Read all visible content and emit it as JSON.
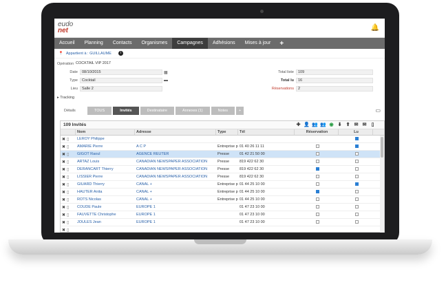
{
  "app": {
    "logo_top": "eudo",
    "logo_bottom": "net"
  },
  "nav": [
    "Accueil",
    "Planning",
    "Contacts",
    "Organismes",
    "Campagnes",
    "Adhésions",
    "Mises à jour"
  ],
  "nav_active": "Campagnes",
  "owner": "Appartient à : GUILLAUME",
  "form": {
    "operation_label": "Opération",
    "operation_value": "COCKTAIL VIP 2017",
    "date_label": "Date",
    "date_value": "08/10/2015",
    "type_label": "Type",
    "type_value": "Cocktail",
    "lieu_label": "Lieu",
    "lieu_value": "Salle 2",
    "total_liste_label": "Total liste",
    "total_liste_value": "109",
    "total_lu_label": "Total lu",
    "total_lu_value": "16",
    "reservations_label": "Réservations",
    "reservations_value": "2"
  },
  "tracking_label": "Tracking",
  "tabs": {
    "label": "Détails",
    "items": [
      "TOUS",
      "Invités",
      "Destinataire",
      "Annexes (1)",
      "Notes",
      "+"
    ],
    "active": "Invités"
  },
  "grid": {
    "title": "109 Invités",
    "columns": [
      "Nom",
      "Adresse",
      "Type",
      "Tél",
      "Réservation",
      "Lu"
    ],
    "rows": [
      {
        "nom": "LEROY Philippe",
        "adresse": "",
        "type": "",
        "tel": "",
        "reservation": null,
        "lu": true,
        "selected": false
      },
      {
        "nom": "AMARIE Pierre",
        "adresse": "A C P",
        "type": "Entreprise p...",
        "tel": "01 40 26 11 11",
        "reservation": false,
        "lu": true,
        "selected": false
      },
      {
        "nom": "GIGOT Raoul",
        "adresse": "AGENCE REUTER",
        "type": "Presse",
        "tel": "01 42 21 50 00",
        "reservation": false,
        "lu": false,
        "selected": true
      },
      {
        "nom": "ARTAZ Louis",
        "adresse": "CANADIAN NEWSPAPER ASSOCIATION",
        "type": "Presse",
        "tel": "819 422 62 30",
        "reservation": false,
        "lu": false,
        "selected": false
      },
      {
        "nom": "DERANCART Thierry",
        "adresse": "CANADIAN NEWSPAPER ASSOCIATION",
        "type": "Presse",
        "tel": "819 422 62 30",
        "reservation": true,
        "lu": false,
        "selected": false
      },
      {
        "nom": "LISSIER Pierre",
        "adresse": "CANADIAN NEWSPAPER ASSOCIATION",
        "type": "Presse",
        "tel": "819 422 62 30",
        "reservation": false,
        "lu": false,
        "selected": false
      },
      {
        "nom": "GIUARD Thierry",
        "adresse": "CANAL +",
        "type": "Entreprise p...",
        "tel": "01 44 25 10 00",
        "reservation": false,
        "lu": true,
        "selected": false
      },
      {
        "nom": "HAUTER Anita",
        "adresse": "CANAL +",
        "type": "Entreprise p...",
        "tel": "01 44 25 10 00",
        "reservation": true,
        "lu": false,
        "selected": false
      },
      {
        "nom": "ROTS Nicolas",
        "adresse": "CANAL +",
        "type": "Entreprise p...",
        "tel": "01 44 25 10 00",
        "reservation": false,
        "lu": false,
        "selected": false
      },
      {
        "nom": "COUDE Paule",
        "adresse": "EUROPE 1",
        "type": "",
        "tel": "01 47 23 10 00",
        "reservation": false,
        "lu": false,
        "selected": false
      },
      {
        "nom": "FAUVETTE Christophe",
        "adresse": "EUROPE 1",
        "type": "",
        "tel": "01 47 23 10 00",
        "reservation": false,
        "lu": false,
        "selected": false
      },
      {
        "nom": "JOULES Jean",
        "adresse": "EUROPE 1",
        "type": "",
        "tel": "01 47 23 10 00",
        "reservation": false,
        "lu": false,
        "selected": false
      },
      {
        "nom": "",
        "adresse": "",
        "type": "",
        "tel": "",
        "reservation": null,
        "lu": null,
        "selected": false
      }
    ]
  },
  "colors": {
    "nav_bg": "#6b6b6b",
    "nav_active": "#3d3d3d",
    "link": "#2860a8",
    "selected_row": "#cfe3f7",
    "accent_red": "#c0392b"
  },
  "icons": [
    "bell-icon",
    "pin-icon",
    "info-icon",
    "calendar-icon",
    "folder-icon",
    "screen-icon",
    "add-icon",
    "user-icon",
    "users-icon",
    "eye-icon",
    "download-icon",
    "upload-icon",
    "mail-icon",
    "document-icon"
  ]
}
